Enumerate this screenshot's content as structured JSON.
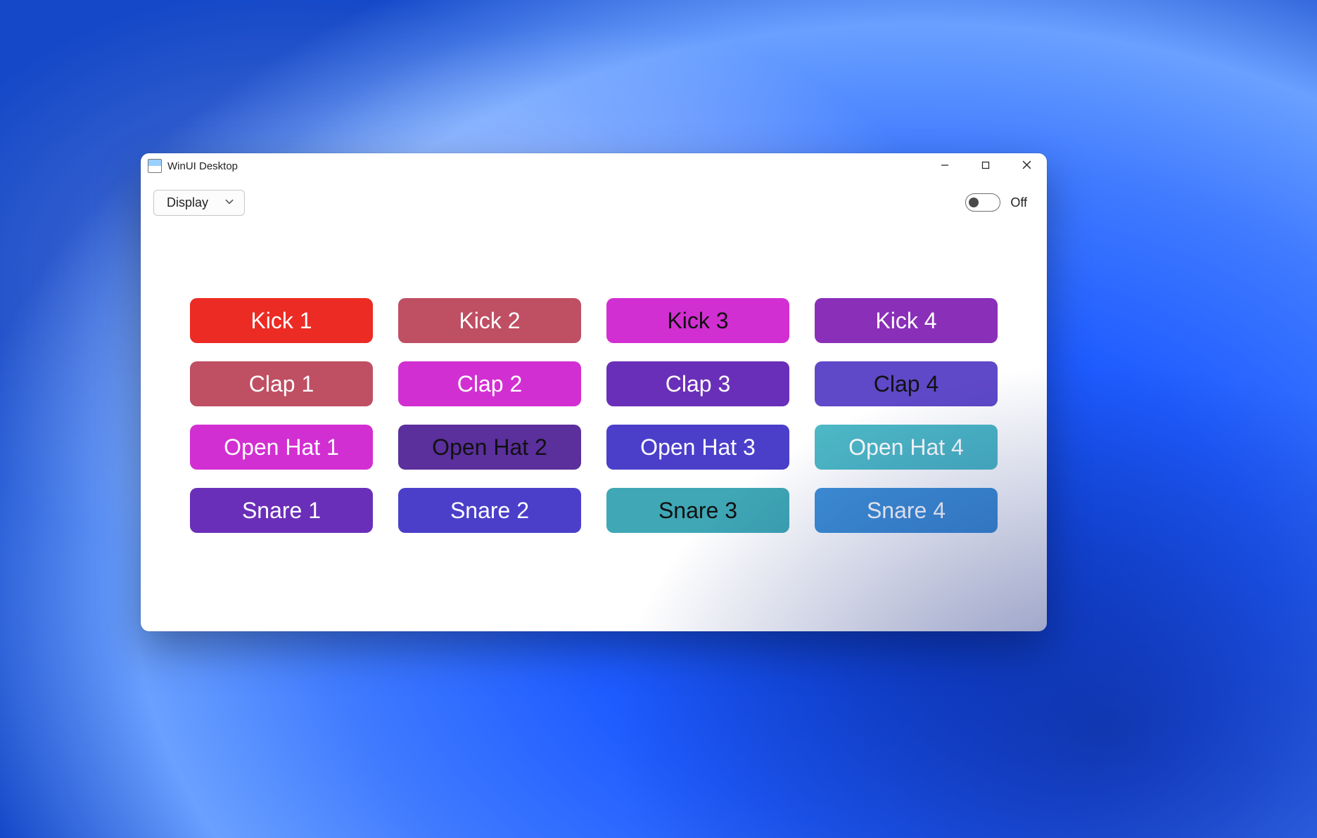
{
  "window": {
    "title": "WinUI Desktop"
  },
  "toolbar": {
    "dropdown_label": "Display",
    "toggle": {
      "state_label": "Off",
      "on": false
    }
  },
  "colors": {
    "red": "#ec2b24",
    "rose": "#bf4f63",
    "magenta": "#d22fd2",
    "purple": "#8a2fb8",
    "violet": "#6a2fb8",
    "deepviolet": "#5b2f9c",
    "indigo": "#5f49c8",
    "royal": "#4b3fca",
    "teal": "#4cb7c5",
    "tealdark": "#3fa7b5",
    "blue": "#3e8fd6"
  },
  "pads": [
    {
      "label": "Kick 1",
      "bg": "red",
      "text": "light"
    },
    {
      "label": "Kick 2",
      "bg": "rose",
      "text": "light"
    },
    {
      "label": "Kick 3",
      "bg": "magenta",
      "text": "dark"
    },
    {
      "label": "Kick 4",
      "bg": "purple",
      "text": "light"
    },
    {
      "label": "Clap 1",
      "bg": "rose",
      "text": "light"
    },
    {
      "label": "Clap 2",
      "bg": "magenta",
      "text": "light"
    },
    {
      "label": "Clap 3",
      "bg": "violet",
      "text": "light"
    },
    {
      "label": "Clap 4",
      "bg": "indigo",
      "text": "dark"
    },
    {
      "label": "Open Hat 1",
      "bg": "magenta",
      "text": "light"
    },
    {
      "label": "Open Hat 2",
      "bg": "deepviolet",
      "text": "dark"
    },
    {
      "label": "Open Hat 3",
      "bg": "royal",
      "text": "light"
    },
    {
      "label": "Open Hat 4",
      "bg": "teal",
      "text": "light"
    },
    {
      "label": "Snare 1",
      "bg": "violet",
      "text": "light"
    },
    {
      "label": "Snare 2",
      "bg": "royal",
      "text": "light"
    },
    {
      "label": "Snare 3",
      "bg": "tealdark",
      "text": "dark"
    },
    {
      "label": "Snare 4",
      "bg": "blue",
      "text": "light"
    }
  ]
}
